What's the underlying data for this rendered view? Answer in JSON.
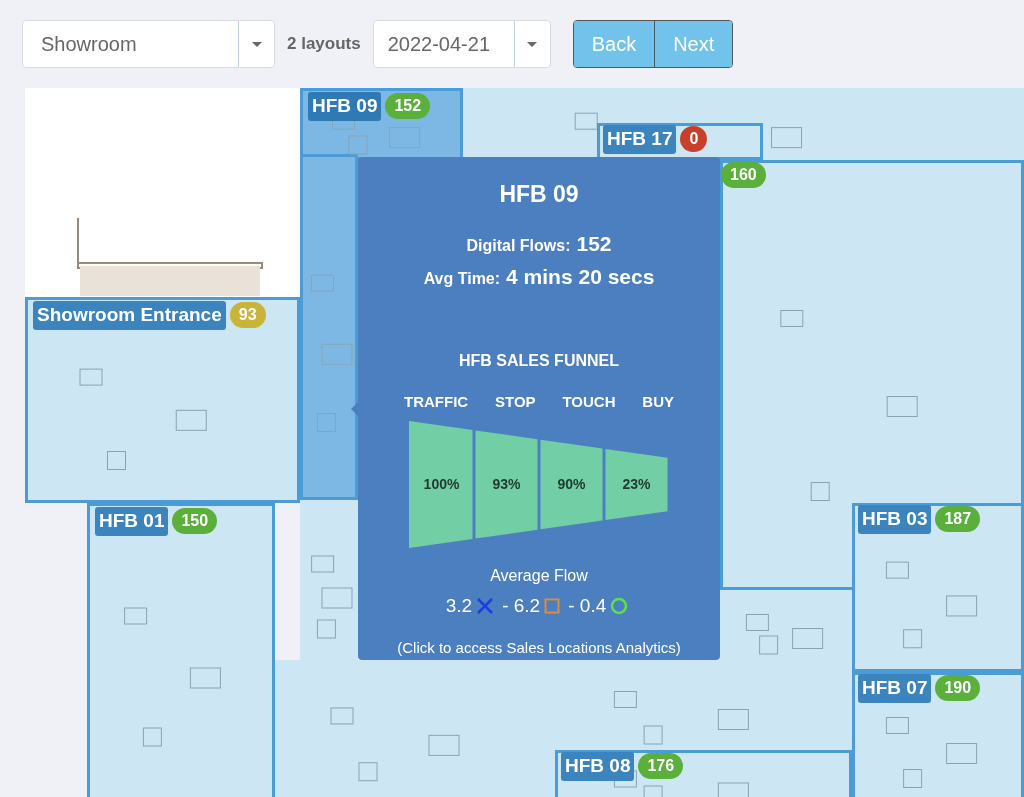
{
  "toolbar": {
    "location_select": {
      "value": "Showroom"
    },
    "layouts_label": "2 layouts",
    "date_select": {
      "value": "2022-04-21"
    },
    "buttons": [
      "Back",
      "Next"
    ]
  },
  "zones": [
    {
      "name": "HFB 09",
      "count": "152",
      "color": "#5ab03a",
      "selected": true
    },
    {
      "name": "HFB 17",
      "count": "0",
      "color": "#c9402a",
      "selected": false
    },
    {
      "count": "160",
      "color": "#5ab03a",
      "selected": false
    },
    {
      "name": "Showroom Entrance",
      "count": "93",
      "color": "#c9b43a",
      "selected": false
    },
    {
      "name": "HFB 01",
      "count": "150",
      "color": "#5ab03a",
      "selected": false
    },
    {
      "name": "HFB 03",
      "count": "187",
      "color": "#5ab03a",
      "selected": false
    },
    {
      "name": "HFB 07",
      "count": "190",
      "color": "#5ab03a",
      "selected": false
    },
    {
      "name": "HFB 08",
      "count": "176",
      "color": "#5ab03a",
      "selected": false
    }
  ],
  "tooltip": {
    "title": "HFB 09",
    "stats": [
      {
        "label": "Digital Flows:",
        "value": "152"
      },
      {
        "label": "Avg Time:",
        "value": "4 mins 20 secs"
      }
    ],
    "funnel_title": "HFB SALES FUNNEL",
    "funnel": [
      {
        "stage": "TRAFFIC",
        "value": "100%"
      },
      {
        "stage": "STOP",
        "value": "93%"
      },
      {
        "stage": "TOUCH",
        "value": "90%"
      },
      {
        "stage": "BUY",
        "value": "23%"
      }
    ],
    "average_flow_title": "Average Flow",
    "average_flow": [
      {
        "value": "3.2",
        "kind": "cross",
        "color": "#1a3fe0"
      },
      {
        "value": "- 6.2",
        "kind": "square",
        "color": "#e08a3a"
      },
      {
        "value": "- 0.4",
        "kind": "circle",
        "color": "#5fe04a"
      }
    ],
    "hint": "(Click to access Sales Locations Analytics)"
  }
}
